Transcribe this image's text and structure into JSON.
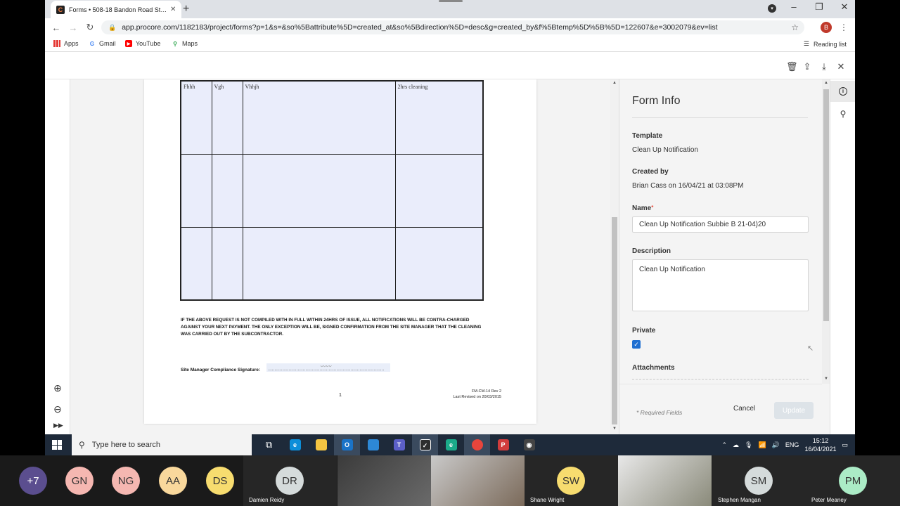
{
  "browser": {
    "tab_title": "Forms • 508-18 Bandon Road St…",
    "url": "app.procore.com/1182183/project/forms?p=1&s=&so%5Battribute%5D=created_at&so%5Bdirection%5D=desc&g=created_by&f%5Btemp%5D%5B%5D=122607&e=3002079&ev=list",
    "profile_initial": "B",
    "bookmarks": [
      "Apps",
      "Gmail",
      "YouTube",
      "Maps"
    ],
    "reading_list": "Reading list"
  },
  "document": {
    "table": {
      "rows": [
        [
          "Fhhh",
          "Vgh",
          "Vhhjh",
          "2hrs cleaning"
        ],
        [
          "",
          "",
          "",
          ""
        ],
        [
          "",
          "",
          "",
          ""
        ]
      ]
    },
    "notice": "IF THE ABOVE REQUEST IS NOT COMPILED WITH IN FULL WITHIN 24HRS OF ISSUE, ALL NOTIFICATIONS WILL BE CONTRA-CHARGED AGAINST YOUR NEXT PAYMENT. THE ONLY EXCEPTION WILL BE, SIGNED CONFIRMATION FROM THE SITE MANAGER THAT THE CLEANING WAS CARRIED OUT BY THE SUBCONTRACTOR.",
    "signature_label": "Site Manager Compliance Signature:",
    "signature_dots": "………………………………………………………………………………",
    "page_number": "1",
    "rev_line1": "FM-CM-14 Rev 2",
    "rev_line2": "Last Revised on 20/03/2015"
  },
  "form_info": {
    "title": "Form Info",
    "template_label": "Template",
    "template_value": "Clean Up Notification",
    "created_by_label": "Created by",
    "created_by_value": "Brian Cass on 16/04/21 at 03:08PM",
    "name_label": "Name",
    "name_value": "Clean Up Notification Subbie B 21-04)20",
    "description_label": "Description",
    "description_value": "Clean Up Notification",
    "private_label": "Private",
    "private_checked": true,
    "attachments_label": "Attachments",
    "required_note": "* Required Fields",
    "cancel_label": "Cancel",
    "update_label": "Update"
  },
  "taskbar": {
    "search_placeholder": "Type here to search",
    "language": "ENG",
    "time": "15:12",
    "date": "16/04/2021"
  },
  "participants": {
    "overflow": "+7",
    "tiles": [
      {
        "initials": "GN",
        "name": "",
        "color": "#f5b7b1"
      },
      {
        "initials": "NG",
        "name": "",
        "color": "#f5b7b1"
      },
      {
        "initials": "AA",
        "name": "",
        "color": "#f9d89c"
      },
      {
        "initials": "DS",
        "name": "",
        "color": "#f7dc6f"
      },
      {
        "initials": "DR",
        "name": "Damien Reidy",
        "color": "#d5dbdb"
      },
      {
        "initials": "",
        "name": "",
        "color": ""
      },
      {
        "initials": "",
        "name": "",
        "color": ""
      },
      {
        "initials": "SW",
        "name": "Shane Wright",
        "color": "#f7dc6f"
      },
      {
        "initials": "",
        "name": "",
        "color": ""
      },
      {
        "initials": "SM",
        "name": "Stephen Mangan",
        "color": "#d5dbdb"
      },
      {
        "initials": "PM",
        "name": "Peter Meaney",
        "color": "#abebc6"
      }
    ]
  }
}
